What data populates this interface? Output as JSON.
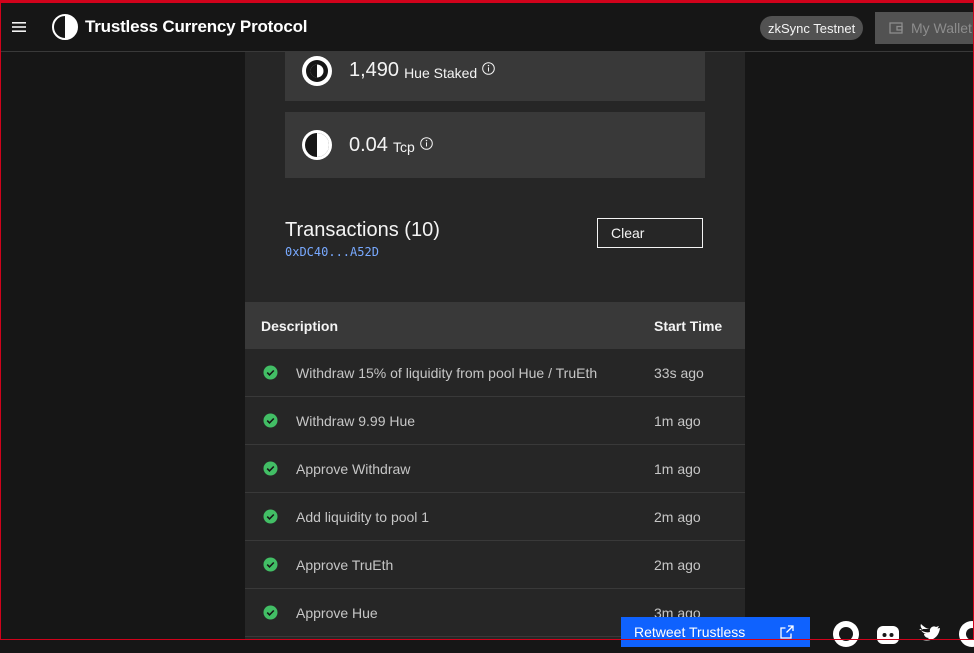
{
  "header": {
    "app_name": "Trustless Currency Protocol",
    "network": "zkSync Testnet",
    "wallet_label": "My Wallet"
  },
  "balances": [
    {
      "value": "1,490",
      "unit": "Hue Staked"
    },
    {
      "value": "0.04",
      "unit": "Tcp"
    }
  ],
  "transactions": {
    "title": "Transactions (10)",
    "address": "0xDC40...A52D",
    "clear_label": "Clear",
    "columns": [
      "Description",
      "Start Time"
    ],
    "rows": [
      {
        "description": "Withdraw 15% of liquidity from pool Hue / TruEth",
        "time": "33s ago"
      },
      {
        "description": "Withdraw 9.99 Hue",
        "time": "1m ago"
      },
      {
        "description": "Approve Withdraw",
        "time": "1m ago"
      },
      {
        "description": "Add liquidity to pool 1",
        "time": "2m ago"
      },
      {
        "description": "Approve TruEth",
        "time": "2m ago"
      },
      {
        "description": "Approve Hue",
        "time": "3m ago"
      }
    ]
  },
  "footer": {
    "retweet_label": "Retweet Trustless"
  },
  "colors": {
    "accent": "#0f62fe",
    "success": "#42be65",
    "address": "#78a9ff"
  }
}
